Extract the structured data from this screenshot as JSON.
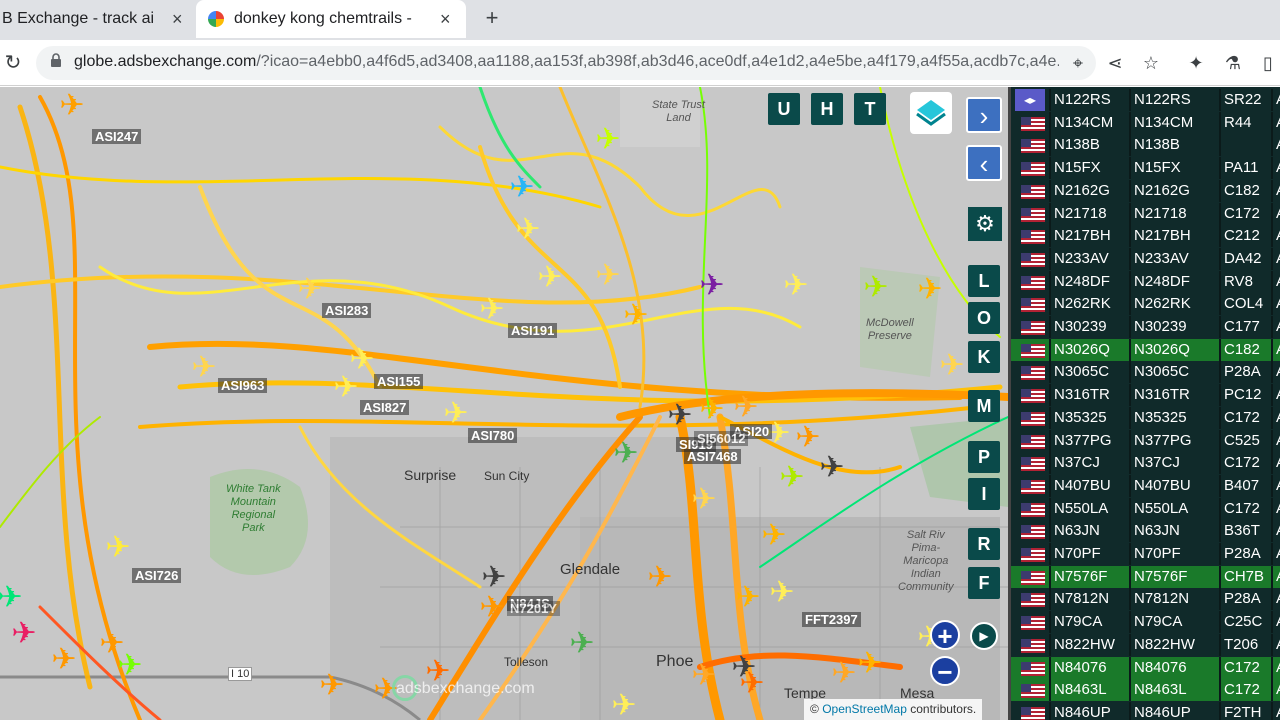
{
  "tabs": [
    {
      "title": "B Exchange - track ai",
      "close": "×",
      "icon": "adsb-icon"
    },
    {
      "title": "donkey kong chemtrails -",
      "close": "×",
      "icon": "google-icon"
    }
  ],
  "new_tab": "+",
  "toolbar": {
    "reload": "↻",
    "lock": "🔒",
    "url_host": "globe.adsbexchange.com",
    "url_path": "/?icao=a4ebb0,a4f6d5,ad3408,aa1188,aa153f,ab398f,ab3d46,ace0df,a4e1d2,a4e5be,a4f179,a4f55a,acdb7c,a4e...",
    "icons": {
      "location": "⌖",
      "share": "⋖",
      "star": "☆",
      "extensions": "✦",
      "lab": "⚗",
      "sidebar": "▯"
    }
  },
  "map": {
    "flight_labels": [
      "ASI247",
      "ASI283",
      "ASI191",
      "ASI963",
      "ASI155",
      "ASI827",
      "ASI780",
      "SI919",
      "ASI7468",
      "ASI20",
      "ASI726",
      "N84JS",
      "N7201Y",
      "FFT2397",
      "SI56012"
    ],
    "places": [
      "Surprise",
      "Sun City",
      "Glendale",
      "Tolleson",
      "Phoe",
      "Tempe",
      "Mesa"
    ],
    "parks": {
      "white_tank": "White Tank\nMountain\nRegional\nPark",
      "state_trust": "State Trust\nLand",
      "mcdowell": "McDowell\nPreserve",
      "salt_river": "Salt Riv\nPima-\nMaricopa\nIndian\nCommunity"
    },
    "highway": "I 10",
    "buttons": {
      "u": "U",
      "h": "H",
      "t": "T",
      "l": "L",
      "o": "O",
      "k": "K",
      "m": "M",
      "p": "P",
      "i": "I",
      "r": "R",
      "f": "F",
      "next": "›",
      "prev": "‹",
      "settings": "⚙",
      "zoom_in": "+",
      "zoom_out": "−",
      "replay": "▶"
    },
    "expand_icon": "◂▸",
    "watermark": "adsbexchange.com",
    "attribution_prefix": "© ",
    "attribution_link": "OpenStreetMap",
    "attribution_suffix": " contributors."
  },
  "colors": {
    "header_tab": "#dfe1e5",
    "table_bg": "#102a2a",
    "highlight_row": "#1a7a2a",
    "button": "#0a4a4a",
    "nav": "#3d70c0"
  },
  "table": {
    "rows": [
      {
        "reg": "N122RS",
        "call": "N122RS",
        "type": "SR22",
        "cat": "A",
        "hl": false
      },
      {
        "reg": "N134CM",
        "call": "N134CM",
        "type": "R44",
        "cat": "A",
        "hl": false
      },
      {
        "reg": "N138B",
        "call": "N138B",
        "type": "",
        "cat": "A",
        "hl": false
      },
      {
        "reg": "N15FX",
        "call": "N15FX",
        "type": "PA11",
        "cat": "A",
        "hl": false
      },
      {
        "reg": "N2162G",
        "call": "N2162G",
        "type": "C182",
        "cat": "A",
        "hl": false
      },
      {
        "reg": "N21718",
        "call": "N21718",
        "type": "C172",
        "cat": "A",
        "hl": false
      },
      {
        "reg": "N217BH",
        "call": "N217BH",
        "type": "C212",
        "cat": "A",
        "hl": false
      },
      {
        "reg": "N233AV",
        "call": "N233AV",
        "type": "DA42",
        "cat": "A",
        "hl": false
      },
      {
        "reg": "N248DF",
        "call": "N248DF",
        "type": "RV8",
        "cat": "A",
        "hl": false
      },
      {
        "reg": "N262RK",
        "call": "N262RK",
        "type": "COL4",
        "cat": "A",
        "hl": false
      },
      {
        "reg": "N30239",
        "call": "N30239",
        "type": "C177",
        "cat": "A",
        "hl": false
      },
      {
        "reg": "N3026Q",
        "call": "N3026Q",
        "type": "C182",
        "cat": "A",
        "hl": true
      },
      {
        "reg": "N3065C",
        "call": "N3065C",
        "type": "P28A",
        "cat": "A",
        "hl": false
      },
      {
        "reg": "N316TR",
        "call": "N316TR",
        "type": "PC12",
        "cat": "A",
        "hl": false
      },
      {
        "reg": "N35325",
        "call": "N35325",
        "type": "C172",
        "cat": "A",
        "hl": false
      },
      {
        "reg": "N377PG",
        "call": "N377PG",
        "type": "C525",
        "cat": "A",
        "hl": false
      },
      {
        "reg": "N37CJ",
        "call": "N37CJ",
        "type": "C172",
        "cat": "A",
        "hl": false
      },
      {
        "reg": "N407BU",
        "call": "N407BU",
        "type": "B407",
        "cat": "A",
        "hl": false
      },
      {
        "reg": "N550LA",
        "call": "N550LA",
        "type": "C172",
        "cat": "A",
        "hl": false
      },
      {
        "reg": "N63JN",
        "call": "N63JN",
        "type": "B36T",
        "cat": "A",
        "hl": false
      },
      {
        "reg": "N70PF",
        "call": "N70PF",
        "type": "P28A",
        "cat": "A",
        "hl": false
      },
      {
        "reg": "N7576F",
        "call": "N7576F",
        "type": "CH7B",
        "cat": "A",
        "hl": true
      },
      {
        "reg": "N7812N",
        "call": "N7812N",
        "type": "P28A",
        "cat": "A",
        "hl": false
      },
      {
        "reg": "N79CA",
        "call": "N79CA",
        "type": "C25C",
        "cat": "A",
        "hl": false
      },
      {
        "reg": "N822HW",
        "call": "N822HW",
        "type": "T206",
        "cat": "A",
        "hl": false
      },
      {
        "reg": "N84076",
        "call": "N84076",
        "type": "C172",
        "cat": "A",
        "hl": true
      },
      {
        "reg": "N8463L",
        "call": "N8463L",
        "type": "C172",
        "cat": "A",
        "hl": true
      },
      {
        "reg": "N846UP",
        "call": "N846UP",
        "type": "F2TH",
        "cat": "A",
        "hl": false
      }
    ]
  }
}
